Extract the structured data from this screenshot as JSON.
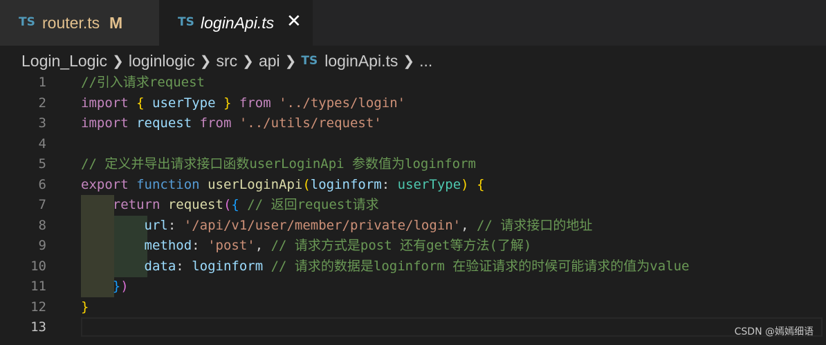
{
  "tabs": [
    {
      "icon": "TS",
      "label": "router.ts",
      "status": "M"
    },
    {
      "icon": "TS",
      "label": "loginApi.ts",
      "close": "✕"
    }
  ],
  "breadcrumb": [
    "Login_Logic",
    "loginlogic",
    "src",
    "api",
    "loginApi.ts",
    "..."
  ],
  "breadcrumb_icon": "TS",
  "line_numbers": [
    "1",
    "2",
    "3",
    "4",
    "5",
    "6",
    "7",
    "8",
    "9",
    "10",
    "11",
    "12",
    "13"
  ],
  "code": {
    "l1_comment": "//引入请求request",
    "l2_import": "import",
    "l2_ob": "{",
    "l2_name": "userType",
    "l2_cb": "}",
    "l2_from": "from",
    "l2_path": "'../types/login'",
    "l3_import": "import",
    "l3_name": "request",
    "l3_from": "from",
    "l3_path": "'../utils/request'",
    "l5_comment": "// 定义并导出请求接口函数userLoginApi 参数值为loginform",
    "l6_export": "export",
    "l6_function": "function",
    "l6_fname": "userLoginApi",
    "l6_op": "(",
    "l6_param": "loginform",
    "l6_colon": ":",
    "l6_type": "userType",
    "l6_cp": ")",
    "l6_ob": "{",
    "l7_return": "return",
    "l7_call": "request",
    "l7_op": "(",
    "l7_ob": "{",
    "l7_comment": "// 返回request请求",
    "l8_key": "url",
    "l8_colon": ":",
    "l8_val": "'/api/v1/user/member/private/login'",
    "l8_comma": ",",
    "l8_comment": "// 请求接口的地址",
    "l9_key": "method",
    "l9_colon": ":",
    "l9_val": "'post'",
    "l9_comma": ",",
    "l9_comment": "// 请求方式是post 还有get等方法(了解)",
    "l10_key": "data",
    "l10_colon": ":",
    "l10_val": "loginform",
    "l10_comment": "// 请求的数据是loginform 在验证请求的时候可能请求的值为value",
    "l11_cb": "}",
    "l11_cp": ")",
    "l12_cb": "}"
  },
  "watermark": "CSDN @嫣嫣细语"
}
